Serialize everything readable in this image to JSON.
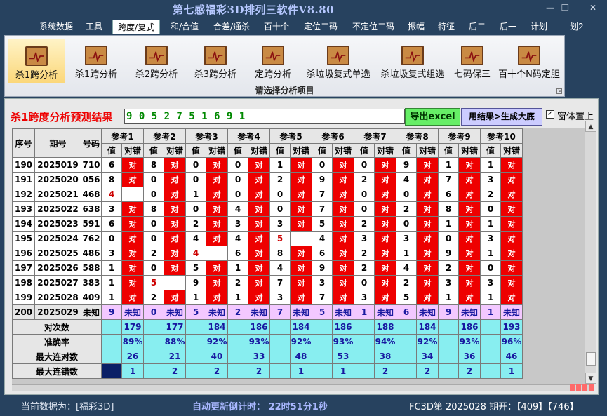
{
  "window": {
    "title": "第七感福彩3D排列三软件V8.80",
    "min": "—",
    "restore": "❐",
    "close": "✕"
  },
  "menu": [
    {
      "label": "系统数据"
    },
    {
      "label": "工具"
    },
    {
      "label": "跨度/复式"
    },
    {
      "label": "和/合值"
    },
    {
      "label": "合差/通杀"
    },
    {
      "label": "百十个"
    },
    {
      "label": "定位二码"
    },
    {
      "label": "不定位二码"
    },
    {
      "label": "振幅"
    },
    {
      "label": "特征"
    },
    {
      "label": "后二"
    },
    {
      "label": "后一"
    },
    {
      "label": "计划"
    },
    {
      "label": "划2"
    }
  ],
  "ribbon": {
    "buttons": [
      {
        "label": "杀1跨分析"
      },
      {
        "label": "杀1跨分析"
      },
      {
        "label": "杀2跨分析"
      },
      {
        "label": "杀3跨分析"
      },
      {
        "label": "定跨分析"
      },
      {
        "label": "杀垃圾复式单选"
      },
      {
        "label": "杀垃圾复式组选"
      },
      {
        "label": "七码保三"
      },
      {
        "label": "百十个N码定胆"
      }
    ],
    "caption": "请选择分析项目"
  },
  "result": {
    "title": "杀1跨度分析预测结果",
    "value": "9 0 5 2 7 5 1 6 9 1",
    "excel_button": "导出excel",
    "generate_button": "用结果>生成大底",
    "checkbox_checked": true,
    "checkbox_label": "窗体置上"
  },
  "table": {
    "col_seq": "序号",
    "col_period": "期号",
    "col_code": "号码",
    "ref_groups": [
      "参考1",
      "参考2",
      "参考3",
      "参考4",
      "参考5",
      "参考6",
      "参考7",
      "参考8",
      "参考9",
      "参考10"
    ],
    "sub_value": "值",
    "sub_result": "对错",
    "rows": [
      {
        "seq": "190",
        "period": "2025019",
        "code": "710",
        "cells": [
          [
            "6",
            "对"
          ],
          [
            "8",
            "对"
          ],
          [
            "0",
            "对"
          ],
          [
            "0",
            "对"
          ],
          [
            "1",
            "对"
          ],
          [
            "0",
            "对"
          ],
          [
            "0",
            "对"
          ],
          [
            "9",
            "对"
          ],
          [
            "1",
            "对"
          ],
          [
            "1",
            "对"
          ]
        ]
      },
      {
        "seq": "191",
        "period": "2025020",
        "code": "056",
        "cells": [
          [
            "8",
            "对"
          ],
          [
            "0",
            "对"
          ],
          [
            "0",
            "对"
          ],
          [
            "0",
            "对"
          ],
          [
            "2",
            "对"
          ],
          [
            "9",
            "对"
          ],
          [
            "2",
            "对"
          ],
          [
            "4",
            "对"
          ],
          [
            "7",
            "对"
          ],
          [
            "3",
            "对"
          ]
        ]
      },
      {
        "seq": "192",
        "period": "2025021",
        "code": "468",
        "cells": [
          [
            "4",
            ""
          ],
          [
            "0",
            "对"
          ],
          [
            "1",
            "对"
          ],
          [
            "0",
            "对"
          ],
          [
            "0",
            "对"
          ],
          [
            "7",
            "对"
          ],
          [
            "0",
            "对"
          ],
          [
            "0",
            "对"
          ],
          [
            "6",
            "对"
          ],
          [
            "2",
            "对"
          ]
        ]
      },
      {
        "seq": "193",
        "period": "2025022",
        "code": "638",
        "cells": [
          [
            "3",
            "对"
          ],
          [
            "8",
            "对"
          ],
          [
            "0",
            "对"
          ],
          [
            "4",
            "对"
          ],
          [
            "0",
            "对"
          ],
          [
            "7",
            "对"
          ],
          [
            "0",
            "对"
          ],
          [
            "2",
            "对"
          ],
          [
            "8",
            "对"
          ],
          [
            "0",
            "对"
          ]
        ]
      },
      {
        "seq": "194",
        "period": "2025023",
        "code": "591",
        "cells": [
          [
            "6",
            "对"
          ],
          [
            "0",
            "对"
          ],
          [
            "2",
            "对"
          ],
          [
            "3",
            "对"
          ],
          [
            "3",
            "对"
          ],
          [
            "5",
            "对"
          ],
          [
            "2",
            "对"
          ],
          [
            "0",
            "对"
          ],
          [
            "1",
            "对"
          ],
          [
            "1",
            "对"
          ]
        ]
      },
      {
        "seq": "195",
        "period": "2025024",
        "code": "762",
        "cells": [
          [
            "0",
            "对"
          ],
          [
            "0",
            "对"
          ],
          [
            "4",
            "对"
          ],
          [
            "4",
            "对"
          ],
          [
            "5",
            ""
          ],
          [
            "4",
            "对"
          ],
          [
            "3",
            "对"
          ],
          [
            "3",
            "对"
          ],
          [
            "0",
            "对"
          ],
          [
            "3",
            "对"
          ]
        ]
      },
      {
        "seq": "196",
        "period": "2025025",
        "code": "486",
        "cells": [
          [
            "3",
            "对"
          ],
          [
            "2",
            "对"
          ],
          [
            "4",
            ""
          ],
          [
            "6",
            "对"
          ],
          [
            "8",
            "对"
          ],
          [
            "6",
            "对"
          ],
          [
            "2",
            "对"
          ],
          [
            "1",
            "对"
          ],
          [
            "9",
            "对"
          ],
          [
            "1",
            "对"
          ]
        ]
      },
      {
        "seq": "197",
        "period": "2025026",
        "code": "588",
        "cells": [
          [
            "1",
            "对"
          ],
          [
            "0",
            "对"
          ],
          [
            "5",
            "对"
          ],
          [
            "1",
            "对"
          ],
          [
            "4",
            "对"
          ],
          [
            "9",
            "对"
          ],
          [
            "2",
            "对"
          ],
          [
            "4",
            "对"
          ],
          [
            "2",
            "对"
          ],
          [
            "0",
            "对"
          ]
        ]
      },
      {
        "seq": "198",
        "period": "2025027",
        "code": "383",
        "cells": [
          [
            "1",
            "对"
          ],
          [
            "5",
            ""
          ],
          [
            "9",
            "对"
          ],
          [
            "2",
            "对"
          ],
          [
            "7",
            "对"
          ],
          [
            "3",
            "对"
          ],
          [
            "0",
            "对"
          ],
          [
            "2",
            "对"
          ],
          [
            "3",
            "对"
          ],
          [
            "3",
            "对"
          ]
        ]
      },
      {
        "seq": "199",
        "period": "2025028",
        "code": "409",
        "cells": [
          [
            "1",
            "对"
          ],
          [
            "2",
            "对"
          ],
          [
            "1",
            "对"
          ],
          [
            "1",
            "对"
          ],
          [
            "3",
            "对"
          ],
          [
            "7",
            "对"
          ],
          [
            "3",
            "对"
          ],
          [
            "5",
            "对"
          ],
          [
            "1",
            "对"
          ],
          [
            "1",
            "对"
          ]
        ]
      }
    ],
    "unknown_row": {
      "seq": "200",
      "period": "2025029",
      "code": "未知",
      "values": [
        "9",
        "0",
        "5",
        "2",
        "7",
        "5",
        "1",
        "6",
        "9",
        "1"
      ],
      "status": "未知"
    },
    "stats": [
      {
        "label": "对次数",
        "values": [
          "179",
          "177",
          "184",
          "186",
          "184",
          "186",
          "188",
          "184",
          "186",
          "193"
        ]
      },
      {
        "label": "准确率",
        "values": [
          "89%",
          "88%",
          "92%",
          "93%",
          "92%",
          "93%",
          "94%",
          "92%",
          "93%",
          "96%"
        ]
      },
      {
        "label": "最大连对数",
        "values": [
          "26",
          "21",
          "40",
          "33",
          "48",
          "53",
          "38",
          "34",
          "36",
          "46"
        ]
      },
      {
        "label": "最大连错数",
        "values": [
          "1",
          "2",
          "2",
          "2",
          "1",
          "1",
          "2",
          "2",
          "2",
          "1"
        ]
      }
    ]
  },
  "status": {
    "current_data": "当前数据为：[福彩3D]",
    "countdown": "自动更新倒计时：  22时51分1秒",
    "draw_info": "FC3D第 2025028 期开：【409】【746】"
  },
  "colors": {
    "title_blue": "#b6c8ff",
    "red_cell": "#ee0000",
    "stat_cyan": "#88eef0",
    "unknown_pink": "#f3c8ff",
    "excel_green": "#66ee66",
    "gen_lavender": "#ccccff"
  }
}
